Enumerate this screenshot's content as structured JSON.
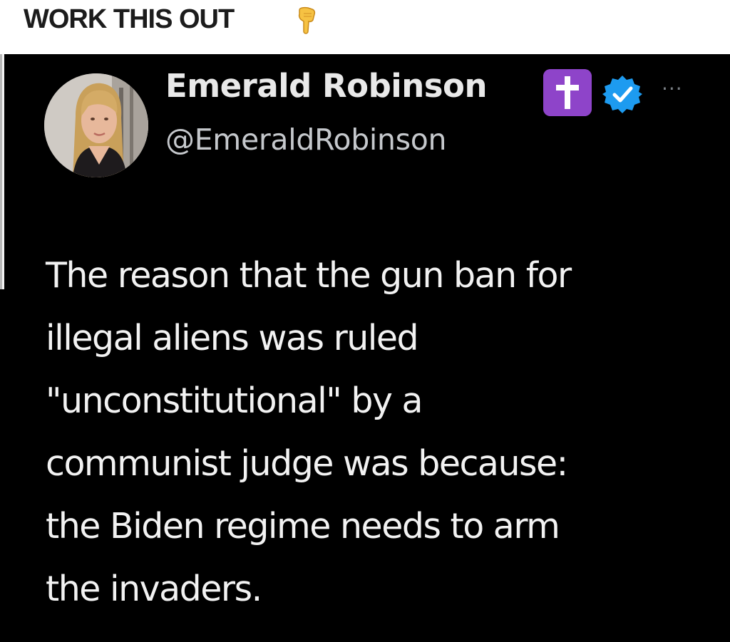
{
  "banner": {
    "title": "WORK THIS OUT",
    "emoji_icon": "pointing-down-hand-icon"
  },
  "tweet": {
    "author": {
      "display_name": "Emerald Robinson",
      "handle": "@EmeraldRobinson",
      "avatar_icon": "profile-photo",
      "badge_icons": [
        "latin-cross-emoji-icon",
        "verified-check-icon"
      ]
    },
    "more_label": "···",
    "body_lines": [
      "The reason that the gun ban for",
      "illegal aliens was ruled",
      "\"unconstitutional\" by a",
      "communist judge was because:",
      "the Biden regime needs to arm",
      "the invaders."
    ]
  },
  "colors": {
    "banner_bg": "#ffffff",
    "tweet_bg": "#000000",
    "text": "#f2f2f2",
    "handle": "#c5c8cc",
    "verified": "#1d9bf0",
    "cross_badge": "#8e44c9"
  }
}
